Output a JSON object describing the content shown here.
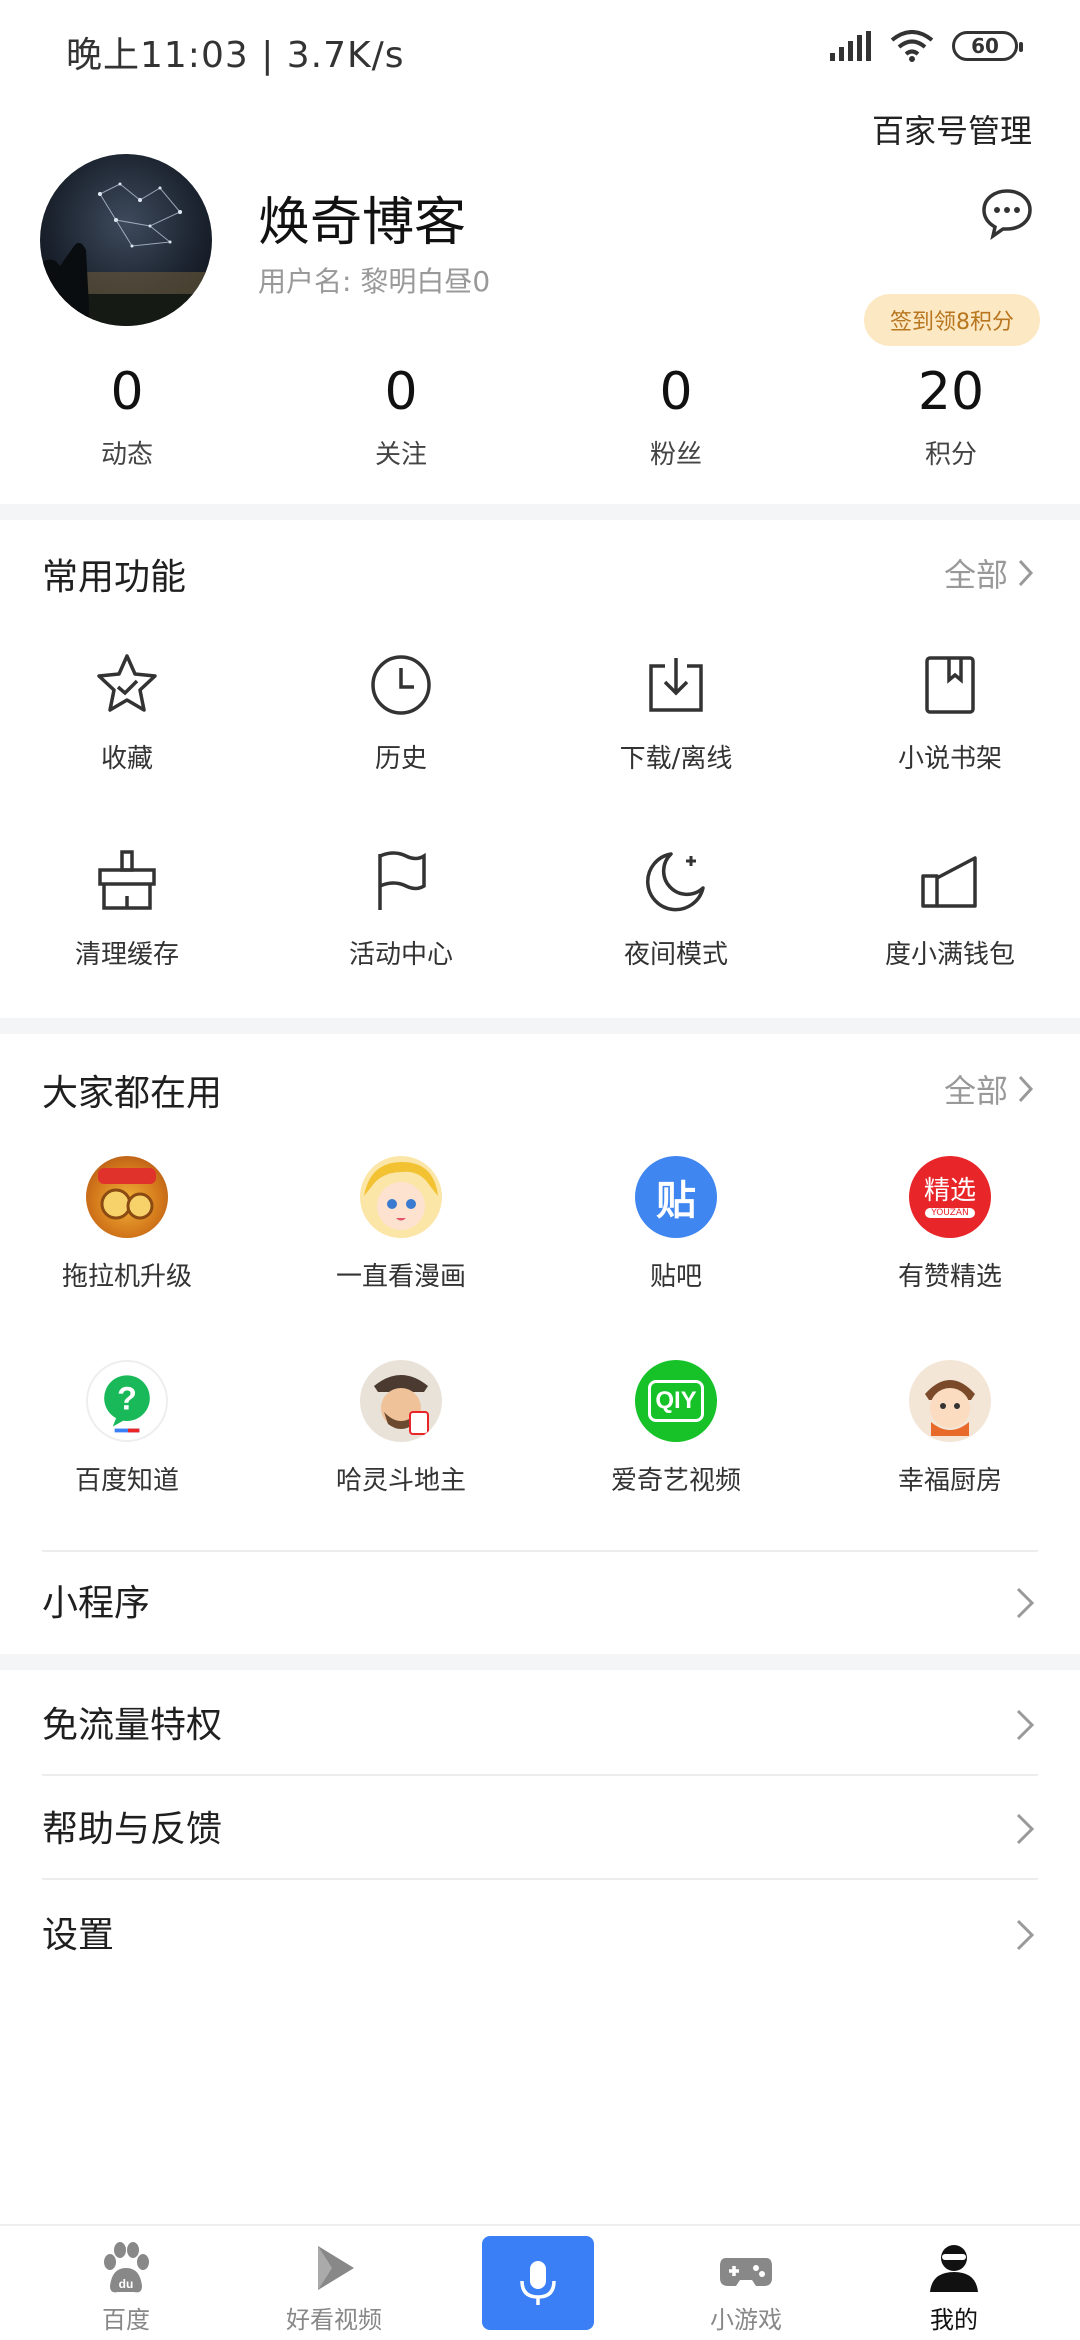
{
  "status_bar": {
    "time": "晚上11:03 | 3.7K/s",
    "battery": "60"
  },
  "profile": {
    "baijiahao_link": "百家号管理",
    "name": "焕奇博客",
    "username": "用户名: 黎明白昼0",
    "sign_badge": "签到领8积分",
    "stats": [
      {
        "value": "0",
        "label": "动态"
      },
      {
        "value": "0",
        "label": "关注"
      },
      {
        "value": "0",
        "label": "粉丝"
      },
      {
        "value": "20",
        "label": "积分"
      }
    ]
  },
  "common": {
    "title": "常用功能",
    "more": "全部",
    "items": [
      {
        "label": "收藏",
        "icon": "star-check-icon"
      },
      {
        "label": "历史",
        "icon": "clock-icon"
      },
      {
        "label": "下载/离线",
        "icon": "download-icon"
      },
      {
        "label": "小说书架",
        "icon": "bookmark-book-icon"
      },
      {
        "label": "清理缓存",
        "icon": "broom-icon"
      },
      {
        "label": "活动中心",
        "icon": "flag-icon"
      },
      {
        "label": "夜间模式",
        "icon": "moon-icon"
      },
      {
        "label": "度小满钱包",
        "icon": "wallet-icon"
      }
    ]
  },
  "popular": {
    "title": "大家都在用",
    "more": "全部",
    "items": [
      {
        "label": "拖拉机升级",
        "icon": "tractor-upgrade-app-icon"
      },
      {
        "label": "一直看漫画",
        "icon": "comic-app-icon"
      },
      {
        "label": "贴吧",
        "icon": "tieba-app-icon",
        "glyph": "贴"
      },
      {
        "label": "有赞精选",
        "icon": "youzan-app-icon",
        "glyph": "精选",
        "subglyph": "YOUZAN"
      },
      {
        "label": "百度知道",
        "icon": "zhidao-app-icon",
        "glyph": "?"
      },
      {
        "label": "哈灵斗地主",
        "icon": "doudizhu-app-icon"
      },
      {
        "label": "爱奇艺视频",
        "icon": "iqiyi-app-icon",
        "glyph": "QIY"
      },
      {
        "label": "幸福厨房",
        "icon": "kitchen-app-icon"
      }
    ]
  },
  "rows": {
    "mini_program": "小程序",
    "free_data": "免流量特权",
    "help": "帮助与反馈",
    "settings": "设置"
  },
  "bottom_nav": {
    "home": "百度",
    "video": "好看视频",
    "games": "小游戏",
    "mine": "我的"
  },
  "colors": {
    "accent_blue": "#3a7ff5",
    "badge_bg": "#fde8c4",
    "badge_text": "#b8761f"
  }
}
